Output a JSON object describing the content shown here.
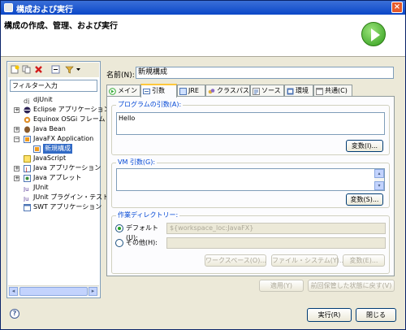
{
  "window": {
    "title": "構成および実行",
    "close_glyph": "×"
  },
  "banner": {
    "heading": "構成の作成、管理、および実行"
  },
  "sidebar": {
    "filter_placeholder": "フィルター入力",
    "tree": [
      {
        "label": "djUnit",
        "expand": ""
      },
      {
        "label": "Eclipse アプリケーション",
        "expand": "+"
      },
      {
        "label": "Equinox OSGi フレーム",
        "expand": ""
      },
      {
        "label": "Java Bean",
        "expand": "+"
      },
      {
        "label": "JavaFX Application",
        "expand": "−"
      },
      {
        "label": "新規構成",
        "expand": ""
      },
      {
        "label": "JavaScript",
        "expand": ""
      },
      {
        "label": "Java アプリケーション",
        "expand": "+"
      },
      {
        "label": "Java アプレット",
        "expand": "+"
      },
      {
        "label": "JUnit",
        "expand": ""
      },
      {
        "label": "JUnit プラグイン・テスト",
        "expand": ""
      },
      {
        "label": "SWT アプリケーション",
        "expand": ""
      }
    ],
    "scroll_left": "◂",
    "scroll_right": "▸"
  },
  "form": {
    "name_label": "名前(N):",
    "name_value": "新規構成",
    "tabs": [
      "メイン",
      "引数",
      "JRE",
      "クラスパス",
      "ソース",
      "環境",
      "共通(C)"
    ],
    "program_args_label": "プログラムの引数(A):",
    "program_args_value": "Hello",
    "variables1_button": "変数(I)...",
    "vm_args_label": "VM 引数(G):",
    "variables2_button": "変数(S)...",
    "workdir_label": "作業ディレクトリー:",
    "default_radio": "デフォルト(U):",
    "default_value": "${workspace_loc:JavaFX}",
    "other_radio": "その他(H):",
    "workspace_button": "ワークスペース(O)...",
    "filesystem_button": "ファイル・システム(Y)...",
    "variables3_button": "変数(E)...",
    "scroll_up": "▴",
    "scroll_down": "▾"
  },
  "bottom": {
    "apply_button": "適用(Y)",
    "revert_button": "前回保管した状態に戻す(V)",
    "run_button": "実行(R)",
    "close_button": "閉じる",
    "help_glyph": "?"
  }
}
